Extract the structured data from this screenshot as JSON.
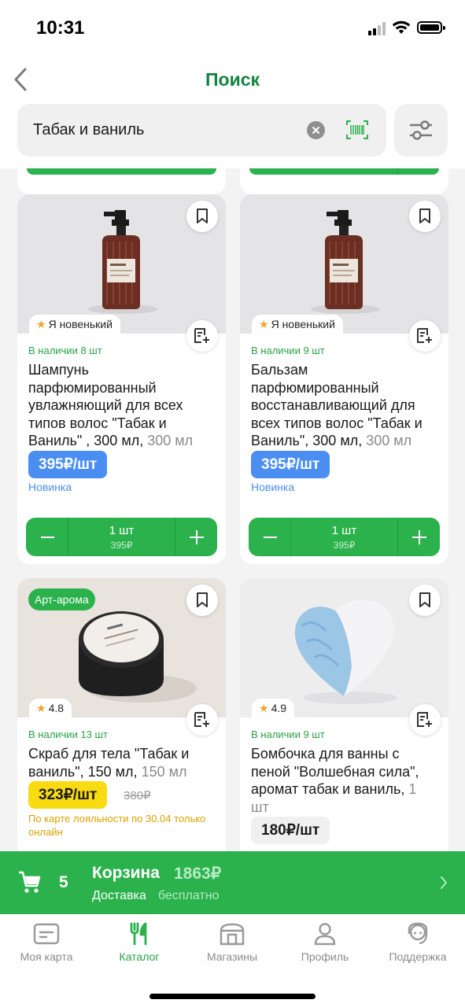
{
  "status_bar": {
    "time": "10:31"
  },
  "header": {
    "title": "Поиск",
    "search": {
      "value": "Табак и ваниль"
    }
  },
  "products": [
    {
      "rating": "Я новенький",
      "stock": "В наличии 8 шт",
      "name": "Шампунь парфюмированный увлажняющий для всех типов волос \"Табак и Ваниль\" , 300 мл, ",
      "volume": "300 мл",
      "price": "395₽/шт",
      "tag": "Новинка",
      "qty": "1 шт",
      "sum": "395₽"
    },
    {
      "rating": "Я новенький",
      "stock": "В наличии 9 шт",
      "name": "Бальзам парфюмированный восстанавливающий для всех типов волос \"Табак и Ваниль\", 300 мл, ",
      "volume": "300 мл",
      "price": "395₽/шт",
      "tag": "Новинка",
      "qty": "1 шт",
      "sum": "395₽"
    },
    {
      "brand": "Арт-арома",
      "rating": "4.8",
      "stock": "В наличии 13 шт",
      "name": "Скраб для тела \"Табак и ваниль\", 150 мл, ",
      "volume": "150 мл",
      "price": "323₽/шт",
      "old_price": "380₽",
      "loyalty": "По карте лояльности по 30.04 только онлайн"
    },
    {
      "rating": "4.9",
      "stock": "В наличии 9 шт",
      "name": "Бомбочка для ванны с пеной \"Волшебная сила\", аромат табак и ваниль, ",
      "volume": "1 шт",
      "price": "180₽/шт"
    }
  ],
  "cart": {
    "count": "5",
    "title": "Корзина",
    "total": "1863₽",
    "delivery_label": "Доставка",
    "delivery_value": "бесплатно"
  },
  "tabs": [
    {
      "label": "Моя карта",
      "icon": "card-icon",
      "active": false
    },
    {
      "label": "Каталог",
      "icon": "fork-knife-icon",
      "active": true
    },
    {
      "label": "Магазины",
      "icon": "store-icon",
      "active": false
    },
    {
      "label": "Профиль",
      "icon": "person-icon",
      "active": false
    },
    {
      "label": "Поддержка",
      "icon": "headset-icon",
      "active": false
    }
  ],
  "colors": {
    "brand_green": "#2bb24c",
    "title_green": "#13843d",
    "price_blue": "#4a8ef2",
    "price_yellow": "#f9db12",
    "rating_star": "#f0a22e"
  }
}
